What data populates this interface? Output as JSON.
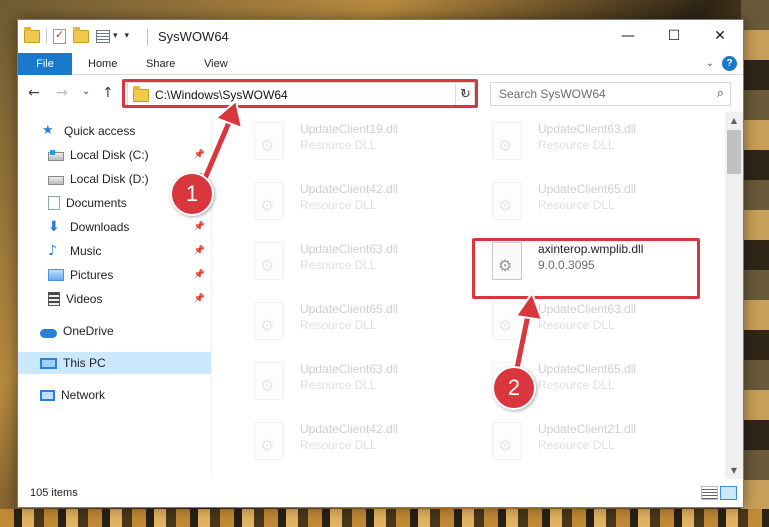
{
  "window": {
    "title": "SysWOW64",
    "controls": {
      "minimize": "—",
      "maximize": "☐",
      "close": "✕"
    }
  },
  "ribbon": {
    "tabs": [
      "File",
      "Home",
      "Share",
      "View"
    ],
    "help": "?"
  },
  "address_bar": {
    "path": "C:\\Windows\\SysWOW64",
    "dropdown_icon": "chevron-down-icon",
    "refresh_icon": "refresh-icon"
  },
  "search": {
    "placeholder": "Search SysWOW64"
  },
  "nav_buttons": {
    "back": "←",
    "forward": "→",
    "recent": "⌄",
    "up": "↑"
  },
  "sidebar": {
    "items": [
      {
        "label": "Quick access",
        "icon": "star-icon"
      },
      {
        "label": "Local Disk (C:)",
        "icon": "drive-icon",
        "pinned": true
      },
      {
        "label": "Local Disk (D:)",
        "icon": "drive-icon",
        "pinned": true
      },
      {
        "label": "Documents",
        "icon": "documents-icon",
        "pinned": true
      },
      {
        "label": "Downloads",
        "icon": "downloads-icon",
        "pinned": true
      },
      {
        "label": "Music",
        "icon": "music-icon",
        "pinned": true
      },
      {
        "label": "Pictures",
        "icon": "pictures-icon",
        "pinned": true
      },
      {
        "label": "Videos",
        "icon": "videos-icon",
        "pinned": true
      },
      {
        "label": "OneDrive",
        "icon": "onedrive-icon"
      },
      {
        "label": "This PC",
        "icon": "this-pc-icon",
        "selected": true
      },
      {
        "label": "Network",
        "icon": "network-icon"
      }
    ]
  },
  "files": [
    {
      "name": "UpdateClient19.dll",
      "sub": "Resource DLL",
      "faded": true
    },
    {
      "name": "UpdateClient63.dll",
      "sub": "Resource DLL",
      "faded": true
    },
    {
      "name": "UpdateClient42.dll",
      "sub": "Resource DLL",
      "faded": true
    },
    {
      "name": "UpdateClient65.dll",
      "sub": "Resource DLL",
      "faded": true
    },
    {
      "name": "UpdateClient63.dll",
      "sub": "Resource DLL",
      "faded": true
    },
    {
      "name": "axinterop.wmplib.dll",
      "sub": "9.0.0.3095",
      "faded": false
    },
    {
      "name": "UpdateClient65.dll",
      "sub": "Resource DLL",
      "faded": true
    },
    {
      "name": "UpdateClient63.dll",
      "sub": "Resource DLL",
      "faded": true
    },
    {
      "name": "UpdateClient63.dll",
      "sub": "Resource DLL",
      "faded": true
    },
    {
      "name": "UpdateClient65.dll",
      "sub": "Resource DLL",
      "faded": true
    },
    {
      "name": "UpdateClient42.dll",
      "sub": "Resource DLL",
      "faded": true
    },
    {
      "name": "UpdateClient21.dll",
      "sub": "Resource DLL",
      "faded": true
    }
  ],
  "status": {
    "item_count": "105 items"
  },
  "annotations": {
    "callout_1": "1",
    "callout_2": "2",
    "highlight_color": "#d9363e"
  },
  "colors": {
    "accent": "#1979ca",
    "selection": "#cce8ff"
  }
}
